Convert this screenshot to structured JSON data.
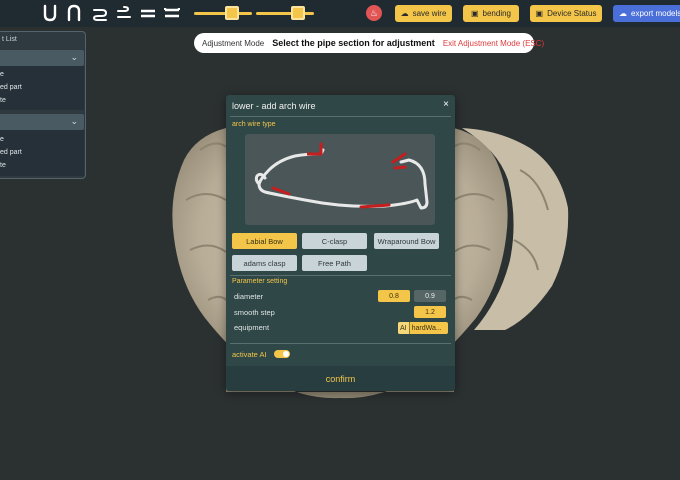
{
  "toolbar": {
    "wire_tools": [
      "u-shape-tool-icon",
      "arch-loop-tool-icon",
      "s-bend-tool-icon",
      "omega-bend-tool-icon",
      "double-line-tool-icon",
      "bracket-line-tool-icon"
    ],
    "sliders": [
      {
        "name": "slider-1",
        "value": 0.66
      },
      {
        "name": "slider-2",
        "value": 0.72
      }
    ],
    "save_wire": "save wire",
    "bending": "bending",
    "device_status": "Device Status",
    "export_models": "export models",
    "accent": "#f3c64a",
    "export_color": "#4a6fd8",
    "bell_color": "#e15555"
  },
  "mode_banner": {
    "label": "Adjustment Mode",
    "instruction": "Select the pipe section for adjustment",
    "exit": "Exit Adjustment Mode (ESC)"
  },
  "left_panel": {
    "title": "t List",
    "groups": [
      {
        "items": [
          "e",
          "ed part",
          "te"
        ]
      },
      {
        "items": [
          "e",
          "ed part",
          "te"
        ]
      }
    ]
  },
  "dialog": {
    "title": "lower - add arch wire",
    "close": "×",
    "arch_wire_type_label": "arch wire type",
    "types": [
      {
        "label": "Labial Bow",
        "active": true
      },
      {
        "label": "C-clasp",
        "active": false
      },
      {
        "label": "Wraparound Bow",
        "active": false
      },
      {
        "label": "adams clasp",
        "active": false
      },
      {
        "label": "Free Path",
        "active": false
      }
    ],
    "parameter_label": "Parameter setting",
    "params": {
      "diameter_label": "diameter",
      "diameter_options": [
        "0.8",
        "0.9"
      ],
      "diameter_selected": "0.8",
      "smooth_step_label": "smooth step",
      "smooth_step_value": "1.2",
      "equipment_label": "equipment",
      "equipment_ai": "AI",
      "equipment_value": "hardWa..."
    },
    "activate_ai_label": "activate AI",
    "activate_ai_on": true,
    "confirm": "confirm"
  }
}
